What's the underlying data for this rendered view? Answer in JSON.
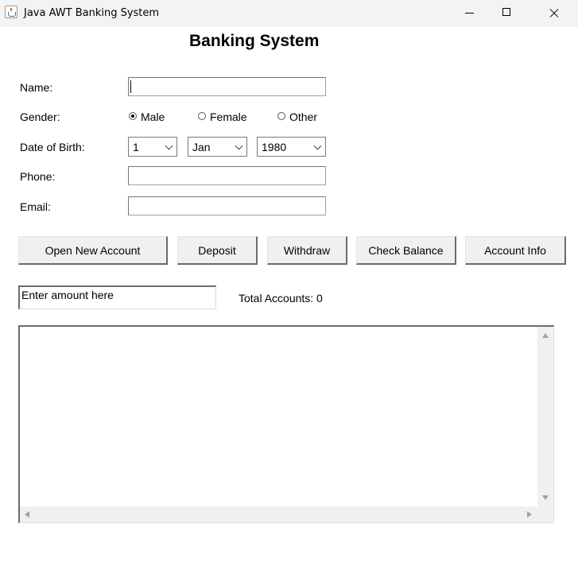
{
  "window": {
    "title": "Java AWT Banking System"
  },
  "form": {
    "heading": "Banking System",
    "name_label": "Name:",
    "name_value": "",
    "gender_label": "Gender:",
    "gender_options": [
      "Male",
      "Female",
      "Other"
    ],
    "gender_selected": "Male",
    "dob_label": "Date of Birth:",
    "dob_day": "1",
    "dob_month": "Jan",
    "dob_year": "1980",
    "phone_label": "Phone:",
    "phone_value": "",
    "email_label": "Email:",
    "email_value": ""
  },
  "actions": {
    "open_account": "Open New Account",
    "deposit": "Deposit",
    "withdraw": "Withdraw",
    "check_balance": "Check Balance",
    "account_info": "Account Info"
  },
  "amount": {
    "value": "Enter amount here"
  },
  "status": {
    "total_accounts": "Total Accounts: 0"
  },
  "output": {
    "text": ""
  }
}
